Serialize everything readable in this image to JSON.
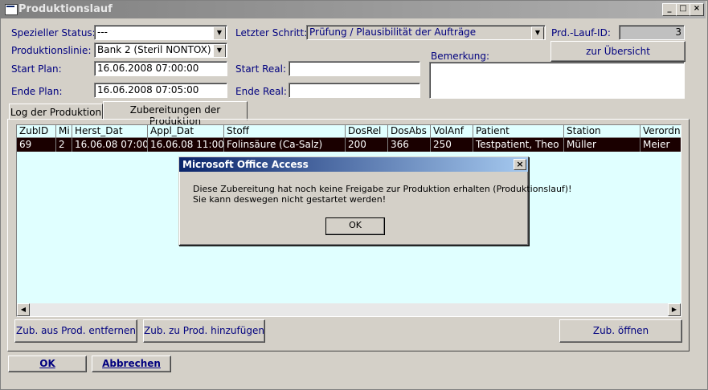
{
  "window": {
    "title": "Produktionslauf"
  },
  "form": {
    "spezieller_status": {
      "label": "Spezieller Status:",
      "value": "---"
    },
    "produktionslinie": {
      "label": "Produktionslinie:",
      "value": "Bank 2 (Steril NONTOX)"
    },
    "start_plan": {
      "label": "Start Plan:",
      "value": "16.06.2008 07:00:00"
    },
    "ende_plan": {
      "label": "Ende Plan:",
      "value": "16.06.2008 07:05:00"
    },
    "letzter_schritt": {
      "label": "Letzter Schritt:",
      "value": "Prüfung / Plausibilität der Aufträge"
    },
    "start_real": {
      "label": "Start Real:",
      "value": ""
    },
    "ende_real": {
      "label": "Ende Real:",
      "value": ""
    },
    "lauf_id": {
      "label": "Prd.-Lauf-ID:",
      "value": "3"
    },
    "bemerkung": {
      "label": "Bemerkung:",
      "value": ""
    },
    "uebersicht_button": "zur Übersicht"
  },
  "tabs": [
    {
      "label": "Log der Produktion"
    },
    {
      "label": "Zubereitungen der Produktion"
    }
  ],
  "table": {
    "columns": [
      "ZubID",
      "Mi",
      "Herst_Dat",
      "Appl_Dat",
      "Stoff",
      "DosRel",
      "DosAbs",
      "VolAnf",
      "Patient",
      "Station",
      "Verordne"
    ],
    "rows": [
      [
        "69",
        "2",
        "16.06.08 07:00",
        "16.06.08 11:00",
        "Folinsäure (Ca-Salz)",
        "200",
        "366",
        "250",
        "Testpatient, Theo",
        "Müller",
        "Meier"
      ]
    ]
  },
  "panel_buttons": {
    "entfernen": "Zub. aus Prod. entfernen",
    "hinzufuegen": "Zub. zu Prod. hinzufügen",
    "oeffnen": "Zub. öffnen"
  },
  "footer_buttons": {
    "ok": "OK",
    "abbrechen": "Abbrechen"
  },
  "dialog": {
    "title": "Microsoft Office Access",
    "line1": "Diese Zubereitung hat noch keine Freigabe zur Produktion erhalten (Produktionslauf)!",
    "line2": "Sie kann deswegen nicht gestartet werden!",
    "ok": "OK"
  },
  "colors": {
    "label_blue": "#00007f",
    "grid_bg": "#e0ffff",
    "selected_row": "#1a0000",
    "dialog_title": "#0a246a"
  }
}
